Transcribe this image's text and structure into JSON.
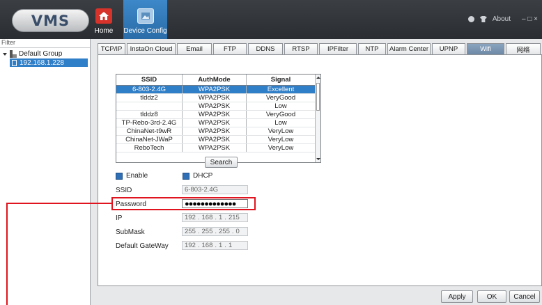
{
  "app": {
    "logo": "VMS"
  },
  "nav": {
    "home": "Home",
    "device_config": "Device Config"
  },
  "top_right": {
    "about": "About",
    "window_controls": "– □ ×"
  },
  "sidebar": {
    "filter_label": "Filter",
    "group": "Default Group",
    "device": "192.168.1.228"
  },
  "tabs": [
    "TCP/IP",
    "InstaOn Cloud",
    "Email",
    "FTP",
    "DDNS",
    "RTSP",
    "IPFilter",
    "NTP",
    "Alarm Center",
    "UPNP",
    "Wifi",
    "网络"
  ],
  "active_tab": "Wifi",
  "wifi_table": {
    "headers": [
      "SSID",
      "AuthMode",
      "Signal"
    ],
    "rows": [
      {
        "ssid": "6-803-2.4G",
        "auth": "WPA2PSK",
        "signal": "Excellent"
      },
      {
        "ssid": "tlddz2",
        "auth": "WPA2PSK",
        "signal": "VeryGood"
      },
      {
        "ssid": "",
        "auth": "WPA2PSK",
        "signal": "Low"
      },
      {
        "ssid": "tlddz8",
        "auth": "WPA2PSK",
        "signal": "VeryGood"
      },
      {
        "ssid": "TP-Rebo-3rd-2.4G",
        "auth": "WPA2PSK",
        "signal": "Low"
      },
      {
        "ssid": "ChinaNet-t9wR",
        "auth": "WPA2PSK",
        "signal": "VeryLow"
      },
      {
        "ssid": "ChinaNet-JWaP",
        "auth": "WPA2PSK",
        "signal": "VeryLow"
      },
      {
        "ssid": "ReboTech",
        "auth": "WPA2PSK",
        "signal": "VeryLow"
      }
    ]
  },
  "search_label": "Search",
  "form": {
    "enable_label": "Enable",
    "dhcp_label": "DHCP",
    "ssid_label": "SSID",
    "ssid_value": "6-803-2.4G",
    "password_label": "Password",
    "password_value": "●●●●●●●●●●●●●",
    "ip_label": "IP",
    "ip": [
      "192",
      "168",
      "1",
      "215"
    ],
    "submask_label": "SubMask",
    "submask": [
      "255",
      "255",
      "255",
      "0"
    ],
    "gateway_label": "Default GateWay",
    "gateway": [
      "192",
      "168",
      "1",
      "1"
    ]
  },
  "buttons": {
    "apply": "Apply",
    "ok": "OK",
    "cancel": "Cancel"
  },
  "colors": {
    "accent": "#2f7ec8",
    "highlight": "#e0141e"
  }
}
